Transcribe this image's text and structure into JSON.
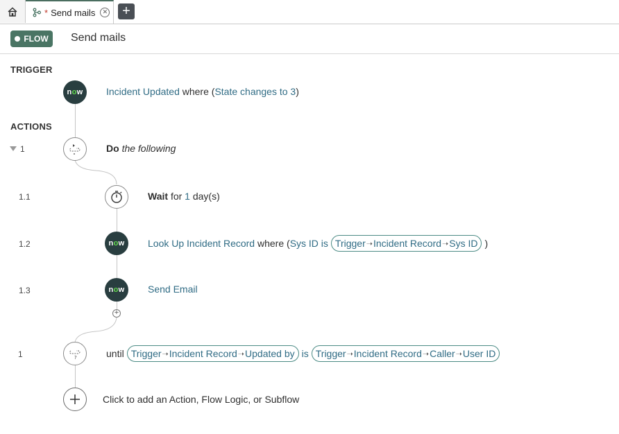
{
  "tabs": {
    "home_label": "Home",
    "active_tab": {
      "title": "Send mails",
      "unsaved_marker": "*"
    },
    "add_tab_label": "+"
  },
  "header": {
    "badge": "FLOW",
    "flow_name": "Send mails"
  },
  "trigger": {
    "section_label": "TRIGGER",
    "icon_text": "now",
    "name": "Incident Updated",
    "where_word": "where",
    "condition": "State changes to 3"
  },
  "actions": {
    "section_label": "ACTIONS",
    "do_block": {
      "number": "1",
      "do": "Do",
      "rest": "the following"
    },
    "wait": {
      "number": "1.1",
      "label": "Wait",
      "for_word": "for",
      "value": "1",
      "unit": "day(s)"
    },
    "lookup": {
      "number": "1.2",
      "name": "Look Up Incident Record",
      "where_word": "where",
      "field": "Sys ID is",
      "pill": [
        "Trigger",
        "Incident Record",
        "Sys ID"
      ]
    },
    "send_email": {
      "number": "1.3",
      "name": "Send Email"
    },
    "until": {
      "number": "1",
      "word": "until",
      "left_pill": [
        "Trigger",
        "Incident Record",
        "Updated by"
      ],
      "operator": "is",
      "right_pill": [
        "Trigger",
        "Incident Record",
        "Caller",
        "User ID"
      ]
    },
    "add_hint": "Click to add an Action, Flow Logic, or Subflow"
  },
  "colors": {
    "accent": "#4a7564",
    "link": "#2f6b84",
    "node_dark": "#293e40"
  }
}
